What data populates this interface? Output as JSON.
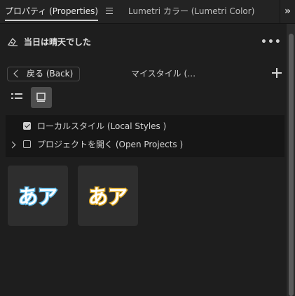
{
  "tabs": {
    "properties": "プロパティ (Properties)",
    "lumetri": "Lumetri カラー (Lumetri Color)"
  },
  "icons": {
    "tab_menu": "hamburger-menu-icon",
    "overflow": "double-chevron-right-icon",
    "text_style": "text-style-icon",
    "more": "more-horizontal-icon",
    "back": "chevron-left-icon",
    "add": "plus-icon",
    "list_view": "list-view-icon",
    "grid_view": "grid-view-icon",
    "expand": "chevron-right-icon"
  },
  "header": {
    "title": "当日は晴天でした",
    "more_label": "•••"
  },
  "nav": {
    "back_label": "戻る (Back)",
    "title": "マイスタイル (…",
    "grid_view_active": true
  },
  "tree": {
    "items": [
      {
        "label": "ローカルスタイル (Local Styles )",
        "checked": true,
        "expandable": false
      },
      {
        "label": "プロジェクトを開く (Open Projects )",
        "checked": false,
        "expandable": true
      }
    ]
  },
  "styles": [
    {
      "text": "あア",
      "fill": "#ffffff",
      "stroke": "#5ab8e8"
    },
    {
      "text": "あア",
      "fill": "#ffffff",
      "stroke": "#e0a820"
    }
  ],
  "colors": {
    "background": "#1e1e1e",
    "panel": "#161616",
    "card": "#2e2e2e",
    "accent_blue": "#5ab8e8",
    "accent_gold": "#e0a820"
  }
}
